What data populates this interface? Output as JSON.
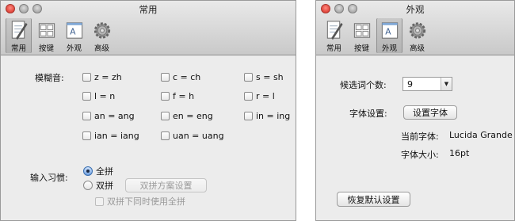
{
  "general_window": {
    "title": "常用",
    "toolbar": [
      "常用",
      "按键",
      "外观",
      "高级"
    ],
    "fuzzy_label": "模糊音:",
    "fuzzy_options": [
      "z = zh",
      "c = ch",
      "s = sh",
      "l = n",
      "f = h",
      "r = l",
      "an = ang",
      "en = eng",
      "in = ing",
      "ian = iang",
      "uan = uang"
    ],
    "input_habit_label": "输入习惯:",
    "quanpin_label": "全拼",
    "shuangpin_label": "双拼",
    "shuangpin_settings_button": "双拼方案设置",
    "shuangpin_also_quanpin": "双拼下同时使用全拼"
  },
  "appearance_window": {
    "title": "外观",
    "toolbar": [
      "常用",
      "按键",
      "外观",
      "高级"
    ],
    "candidate_count_label": "候选词个数:",
    "candidate_count_value": "9",
    "font_settings_label": "字体设置:",
    "font_settings_button": "设置字体",
    "current_font_label": "当前字体:",
    "current_font_value": "Lucida Grande",
    "font_size_label": "字体大小:",
    "font_size_value": "16pt",
    "restore_defaults_button": "恢复默认设置"
  }
}
